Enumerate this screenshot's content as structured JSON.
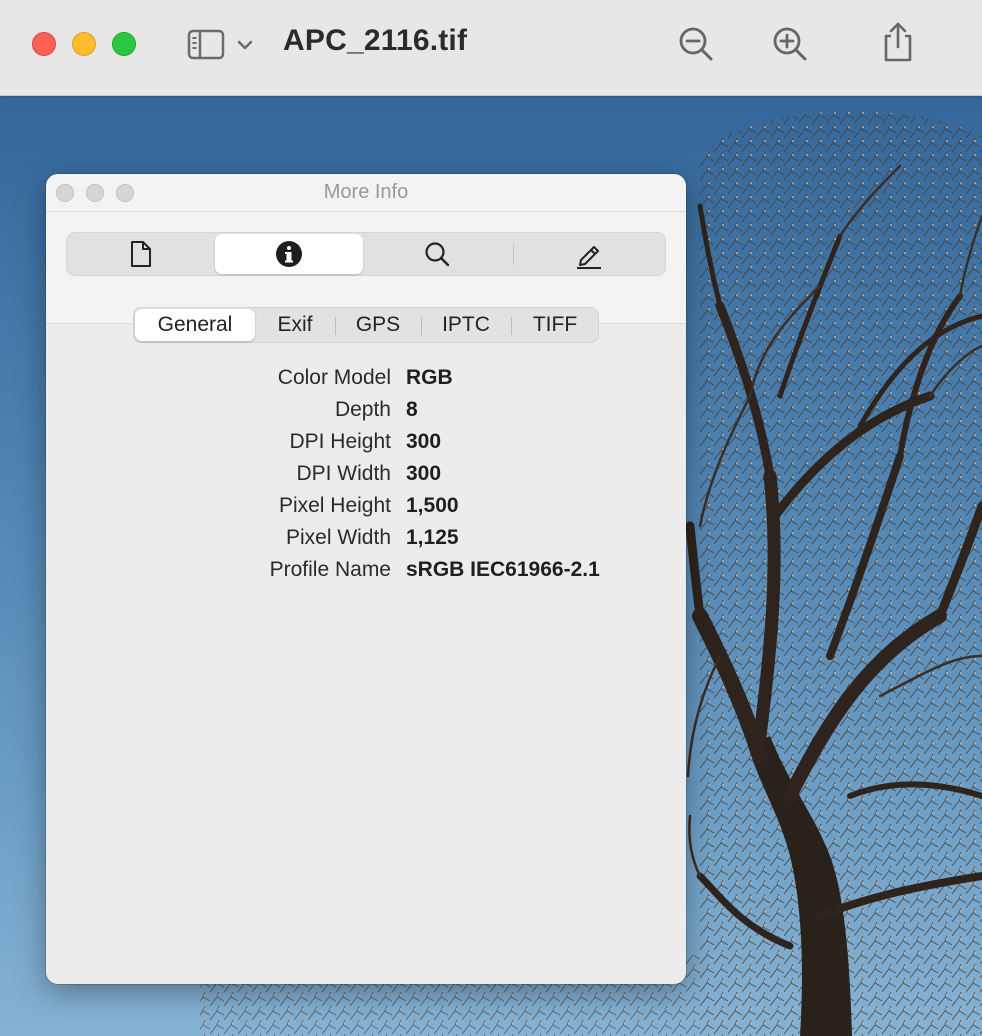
{
  "window": {
    "title": "APC_2116.tif",
    "icons": [
      "sidebar-toggle-icon",
      "chevron-down-icon",
      "zoom-out-icon",
      "zoom-in-icon",
      "share-icon"
    ]
  },
  "panel": {
    "title": "More Info",
    "inspector_tabs": [
      {
        "name": "file-info",
        "icon": "document-icon"
      },
      {
        "name": "more-info",
        "icon": "info-circle-icon",
        "selected": true
      },
      {
        "name": "keywords",
        "icon": "magnifier-icon"
      },
      {
        "name": "annotations",
        "icon": "pencil-icon"
      }
    ],
    "subtabs": [
      "General",
      "Exif",
      "GPS",
      "IPTC",
      "TIFF"
    ],
    "selected_subtab": "General",
    "properties": [
      {
        "key": "Color Model",
        "value": "RGB"
      },
      {
        "key": "Depth",
        "value": "8"
      },
      {
        "key": "DPI Height",
        "value": "300"
      },
      {
        "key": "DPI Width",
        "value": "300"
      },
      {
        "key": "Pixel Height",
        "value": "1,500"
      },
      {
        "key": "Pixel Width",
        "value": "1,125"
      },
      {
        "key": "Profile Name",
        "value": "sRGB IEC61966-2.1"
      }
    ]
  },
  "colors": {
    "close": "#fe5f57",
    "minimize": "#febc2e",
    "zoom": "#28c840",
    "sky": "#4a7fae"
  }
}
